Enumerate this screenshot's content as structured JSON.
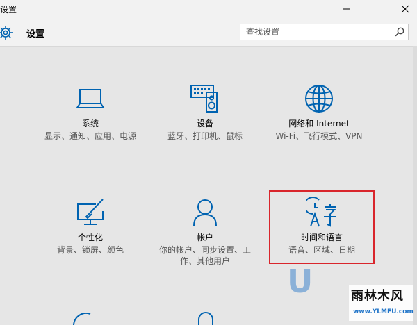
{
  "window": {
    "title": "设置"
  },
  "header": {
    "title": "设置"
  },
  "search": {
    "placeholder": "查找设置"
  },
  "tiles": [
    {
      "name": "系统",
      "desc": "显示、通知、应用、电源",
      "icon": "laptop-icon"
    },
    {
      "name": "设备",
      "desc": "蓝牙、打印机、鼠标",
      "icon": "keyboard-speaker-icon"
    },
    {
      "name": "网络和 Internet",
      "desc": "Wi-Fi、飞行模式、VPN",
      "icon": "globe-icon"
    },
    {
      "name": "个性化",
      "desc": "背景、锁屏、颜色",
      "icon": "paint-monitor-icon"
    },
    {
      "name": "帐户",
      "desc": "你的帐户、同步设置、工作、其他用户",
      "icon": "person-icon"
    },
    {
      "name": "时间和语言",
      "desc": "语音、区域、日期",
      "icon": "time-language-icon"
    }
  ],
  "watermark": {
    "letter": "U",
    "brand": "雨林木风",
    "url": "www.YLMFU.com"
  },
  "colors": {
    "accent": "#0063b1",
    "highlight": "#d9262c",
    "background": "#e6e6e6"
  }
}
